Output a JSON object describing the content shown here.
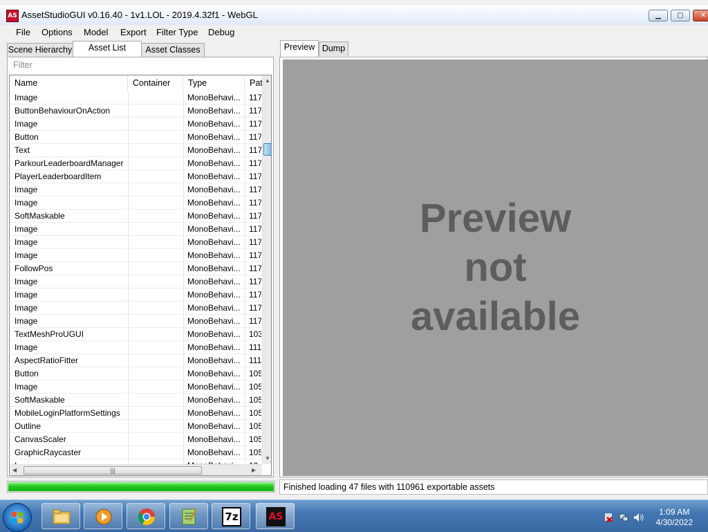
{
  "window": {
    "title": "AssetStudioGUI v0.16.40 - 1v1.LOL - 2019.4.32f1 - WebGL",
    "app_icon_text": "AS",
    "buttons": {
      "minimize": "▁",
      "maximize": "▢",
      "close": "✕"
    }
  },
  "menu": [
    "File",
    "Options",
    "Model",
    "Export",
    "Filter Type",
    "Debug"
  ],
  "left_tabs": [
    "Scene Hierarchy",
    "Asset List",
    "Asset Classes"
  ],
  "left_active_tab": "Asset List",
  "filter_placeholder": "Filter",
  "columns": [
    "Name",
    "Container",
    "Type",
    "Pat"
  ],
  "rows": [
    {
      "name": "Image",
      "container": "",
      "type": "MonoBehavi...",
      "path": "117"
    },
    {
      "name": "ButtonBehaviourOnAction",
      "container": "",
      "type": "MonoBehavi...",
      "path": "117"
    },
    {
      "name": "Image",
      "container": "",
      "type": "MonoBehavi...",
      "path": "117"
    },
    {
      "name": "Button",
      "container": "",
      "type": "MonoBehavi...",
      "path": "117"
    },
    {
      "name": "Text",
      "container": "",
      "type": "MonoBehavi...",
      "path": "117"
    },
    {
      "name": "ParkourLeaderboardManager",
      "container": "",
      "type": "MonoBehavi...",
      "path": "117"
    },
    {
      "name": "PlayerLeaderboardItem",
      "container": "",
      "type": "MonoBehavi...",
      "path": "117"
    },
    {
      "name": "Image",
      "container": "",
      "type": "MonoBehavi...",
      "path": "117"
    },
    {
      "name": "Image",
      "container": "",
      "type": "MonoBehavi...",
      "path": "117"
    },
    {
      "name": "SoftMaskable",
      "container": "",
      "type": "MonoBehavi...",
      "path": "117"
    },
    {
      "name": "Image",
      "container": "",
      "type": "MonoBehavi...",
      "path": "117"
    },
    {
      "name": "Image",
      "container": "",
      "type": "MonoBehavi...",
      "path": "117"
    },
    {
      "name": "Image",
      "container": "",
      "type": "MonoBehavi...",
      "path": "117"
    },
    {
      "name": "FollowPos",
      "container": "",
      "type": "MonoBehavi...",
      "path": "117"
    },
    {
      "name": "Image",
      "container": "",
      "type": "MonoBehavi...",
      "path": "117"
    },
    {
      "name": "Image",
      "container": "",
      "type": "MonoBehavi...",
      "path": "117"
    },
    {
      "name": "Image",
      "container": "",
      "type": "MonoBehavi...",
      "path": "117"
    },
    {
      "name": "Image",
      "container": "",
      "type": "MonoBehavi...",
      "path": "117"
    },
    {
      "name": "TextMeshProUGUI",
      "container": "",
      "type": "MonoBehavi...",
      "path": "103"
    },
    {
      "name": "Image",
      "container": "",
      "type": "MonoBehavi...",
      "path": "111"
    },
    {
      "name": "AspectRatioFitter",
      "container": "",
      "type": "MonoBehavi...",
      "path": "111"
    },
    {
      "name": "Button",
      "container": "",
      "type": "MonoBehavi...",
      "path": "105"
    },
    {
      "name": "Image",
      "container": "",
      "type": "MonoBehavi...",
      "path": "105"
    },
    {
      "name": "SoftMaskable",
      "container": "",
      "type": "MonoBehavi...",
      "path": "105"
    },
    {
      "name": "MobileLoginPlatformSettings",
      "container": "",
      "type": "MonoBehavi...",
      "path": "105"
    },
    {
      "name": "Outline",
      "container": "",
      "type": "MonoBehavi...",
      "path": "105"
    },
    {
      "name": "CanvasScaler",
      "container": "",
      "type": "MonoBehavi...",
      "path": "105"
    },
    {
      "name": "GraphicRaycaster",
      "container": "",
      "type": "MonoBehavi...",
      "path": "105"
    },
    {
      "name": "I...",
      "container": "",
      "type": "MonoBehavi...",
      "path": "10"
    }
  ],
  "progress_fraction": 1.0,
  "right_tabs": [
    "Preview",
    "Dump"
  ],
  "right_active_tab": "Preview",
  "preview_text": [
    "Preview",
    "not",
    "available"
  ],
  "status": "Finished loading 47 files with 110961 exportable assets",
  "taskbar": {
    "buttons": [
      "explorer-icon",
      "media-player-icon",
      "chrome-icon",
      "notepad-plus-icon",
      "7zip-icon",
      "assetstudio-icon"
    ],
    "sevenzip_label": "7z",
    "assetstudio_label": "AS",
    "time": "1:09 AM",
    "date": "4/30/2022"
  },
  "colors": {
    "progress": "#1dc41a",
    "preview_bg": "#9f9f9f",
    "taskbar": "#4376b0"
  }
}
